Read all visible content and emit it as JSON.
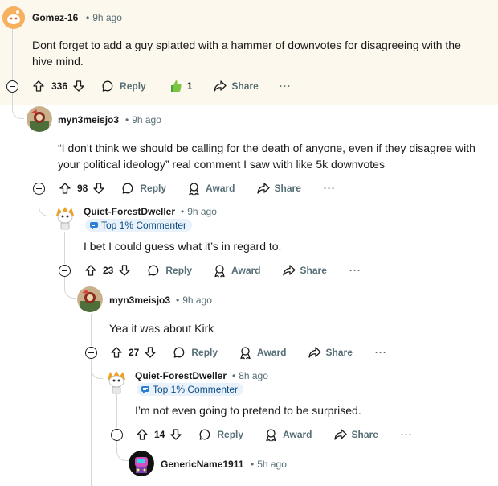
{
  "comments": [
    {
      "user": "Gomez-16",
      "time": "9h ago",
      "body": "Dont forget to add a guy splatted with a hammer of downvotes for disagreeing with the hive mind.",
      "votes": "336",
      "award_count": "1"
    },
    {
      "user": "myn3meisjo3",
      "time": "9h ago",
      "body_line1": "“I don’t think we should be calling for the death of anyone, even if they disagree with",
      "body_line2": "your political ideology” real comment I saw with like 5k downvotes",
      "votes": "98"
    },
    {
      "user": "Quiet-ForestDweller",
      "time": "9h ago",
      "badge": "Top 1% Commenter",
      "body": "I bet I could guess what it’s in regard to.",
      "votes": "23"
    },
    {
      "user": "myn3meisjo3",
      "time": "9h ago",
      "body": "Yea it was about Kirk",
      "votes": "27"
    },
    {
      "user": "Quiet-ForestDweller",
      "time": "8h ago",
      "badge": "Top 1% Commenter",
      "body": "I’m not even going to pretend to be surprised.",
      "votes": "14"
    },
    {
      "user": "GenericName1911",
      "time": "5h ago"
    }
  ],
  "actions": {
    "reply": "Reply",
    "award": "Award",
    "share": "Share",
    "more": "···",
    "dot": "•"
  }
}
